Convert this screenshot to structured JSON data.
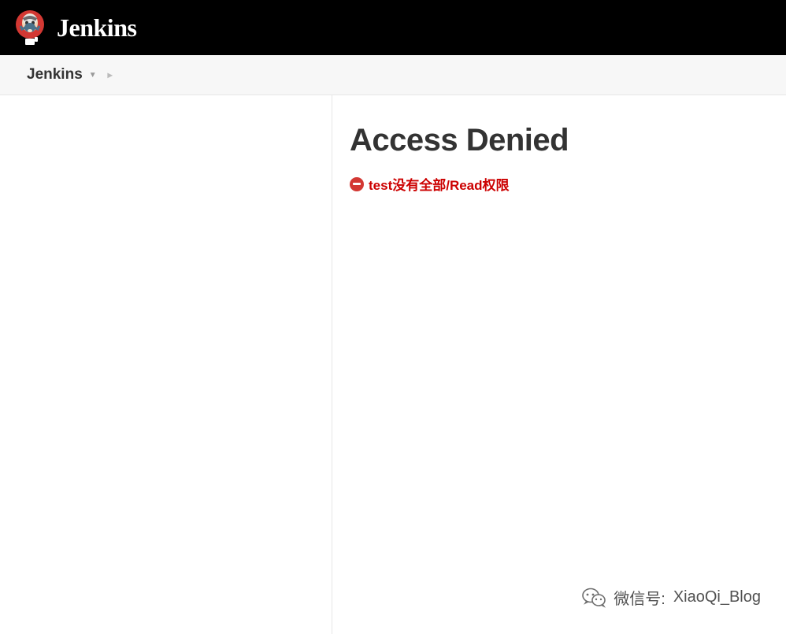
{
  "header": {
    "brand": "Jenkins"
  },
  "breadcrumb": {
    "items": [
      {
        "label": "Jenkins"
      }
    ]
  },
  "main": {
    "title": "Access Denied",
    "error_message": "test没有全部/Read权限"
  },
  "watermark": {
    "label": "微信号:",
    "value": "XiaoQi_Blog"
  }
}
